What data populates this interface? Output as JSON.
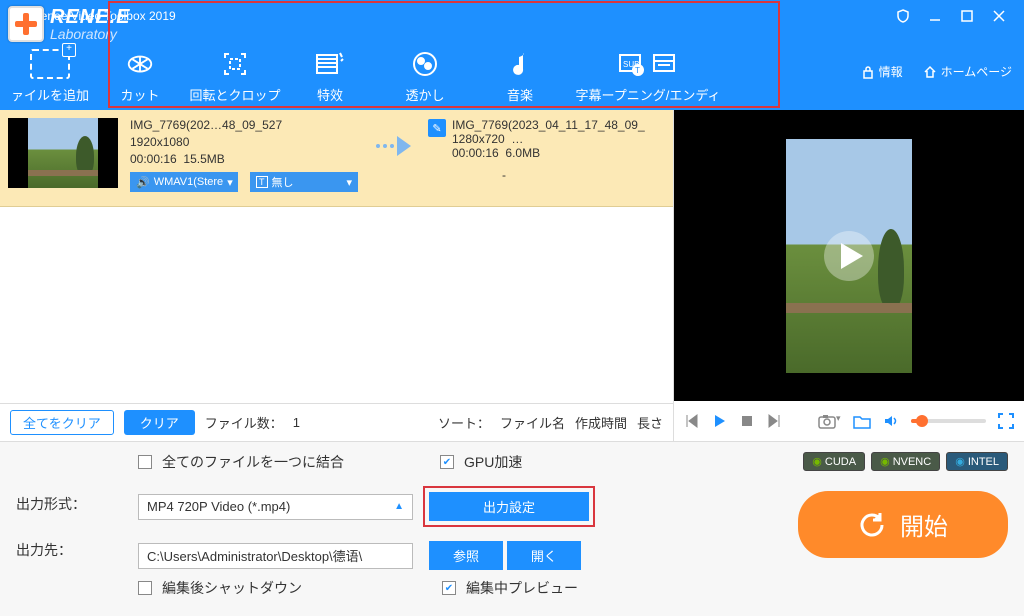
{
  "title": "Renee Video Toolbox 2019",
  "logo": {
    "l1": "RENE.E",
    "l2": "Laboratory"
  },
  "toolbar": {
    "addfile": "ァイルを追加",
    "tools": [
      {
        "id": "cut",
        "label": "カット"
      },
      {
        "id": "rotate",
        "label": "回転とクロップ"
      },
      {
        "id": "effect",
        "label": "特效"
      },
      {
        "id": "watermark",
        "label": "透かし"
      },
      {
        "id": "music",
        "label": "音楽"
      },
      {
        "id": "subtitle",
        "label": "字幕ープニング/エンディ"
      }
    ],
    "right": {
      "info": "情報",
      "home": "ホームページ"
    }
  },
  "filerow": {
    "src": {
      "name": "IMG_7769(202…48_09_527",
      "res": "1920x1080",
      "dur": "00:00:16",
      "size": "15.5MB"
    },
    "dst": {
      "name": "IMG_7769(2023_04_11_17_48_09_",
      "res": "1280x720",
      "resx": "…",
      "dur": "00:00:16",
      "size": "6.0MB"
    },
    "pill_audio": "WMAV1(Stere",
    "pill_sub": "無し",
    "pill_dash": "-"
  },
  "controls": {
    "clear_all": "全てをクリア",
    "clear": "クリア",
    "files_label": "ファイル数：",
    "files_count": "1",
    "sort_label": "ソート：",
    "sort_opts": [
      "ファイル名",
      "作成時間",
      "長さ"
    ]
  },
  "bottom": {
    "merge": "全てのファイルを一つに結合",
    "gpu": "GPU加速",
    "hw": [
      "CUDA",
      "NVENC",
      "INTEL"
    ],
    "outfmt_label": "出力形式：",
    "outfmt_value": "MP4 720P Video (*.mp4)",
    "outset": "出力設定",
    "outdst_label": "出力先：",
    "outdst_value": "C:\\Users\\Administrator\\Desktop\\德语\\",
    "browse": "参照",
    "open": "開く",
    "shutdown": "編集後シャットダウン",
    "preview_edit": "編集中プレビュー",
    "start": "開始"
  }
}
